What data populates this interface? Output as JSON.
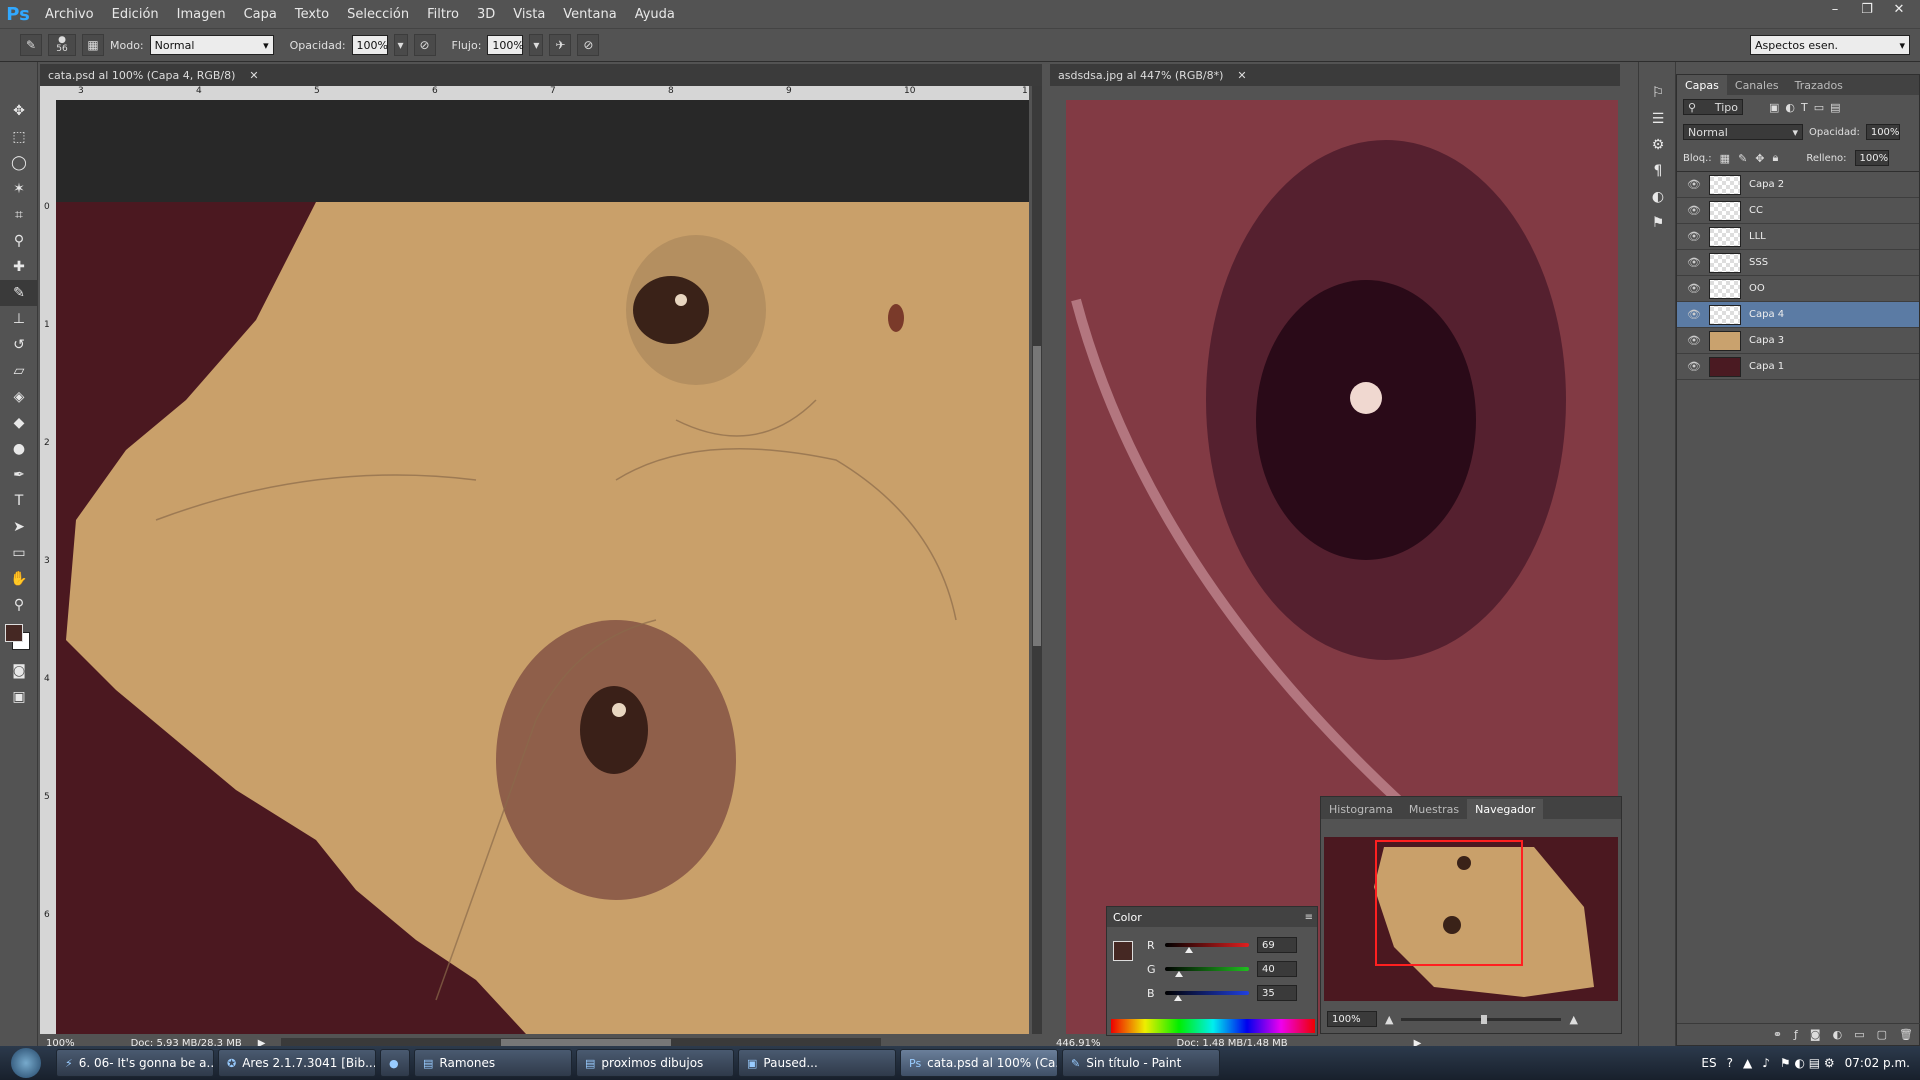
{
  "app": {
    "logo": "Ps"
  },
  "menu": [
    "Archivo",
    "Edición",
    "Imagen",
    "Capa",
    "Texto",
    "Selección",
    "Filtro",
    "3D",
    "Vista",
    "Ventana",
    "Ayuda"
  ],
  "window_controls": [
    "–",
    "❐",
    "✕"
  ],
  "options_bar": {
    "brush_size": "56",
    "mode_label": "Modo:",
    "mode_value": "Normal",
    "opacity_label": "Opacidad:",
    "opacity_value": "100%",
    "flow_label": "Flujo:",
    "flow_value": "100%",
    "workspace": "Aspectos esen."
  },
  "documents": [
    {
      "tab": "cata.psd al 100% (Capa 4, RGB/8)",
      "zoom": "100%",
      "doc_info": "Doc: 5,93 MB/28,3 MB",
      "ruler_marks": [
        "3",
        "4",
        "5",
        "6",
        "7",
        "8",
        "9",
        "10",
        "1"
      ],
      "v_ruler_marks": [
        "0",
        "1",
        "2",
        "3",
        "4",
        "5",
        "6"
      ]
    },
    {
      "tab": "asdsdsa.jpg al 447% (RGB/8*)",
      "zoom": "446,91%",
      "doc_info": "Doc: 1,48 MB/1,48 MB"
    }
  ],
  "layers_panel": {
    "tabs": [
      "Capas",
      "Canales",
      "Trazados"
    ],
    "filter": "Tipo",
    "blend_mode": "Normal",
    "opacity_label": "Opacidad:",
    "opacity_value": "100%",
    "lock_label": "Bloq.:",
    "fill_label": "Relleno:",
    "fill_value": "100%",
    "layers": [
      {
        "name": "Capa 2",
        "thumb": "checker",
        "selected": false
      },
      {
        "name": "CC",
        "thumb": "checker",
        "selected": false
      },
      {
        "name": "LLL",
        "thumb": "checker",
        "selected": false
      },
      {
        "name": "SSS",
        "thumb": "checker",
        "selected": false
      },
      {
        "name": "OO",
        "thumb": "checker",
        "selected": false
      },
      {
        "name": "Capa 4",
        "thumb": "checker",
        "selected": true
      },
      {
        "name": "Capa 3",
        "thumb": "#c9a26e",
        "selected": false
      },
      {
        "name": "Capa 1",
        "thumb": "#4a1a22",
        "selected": false
      }
    ]
  },
  "navigator_panel": {
    "tabs": [
      "Histograma",
      "Muestras",
      "Navegador"
    ],
    "zoom": "100%"
  },
  "color_panel": {
    "title": "Color",
    "channels": [
      {
        "label": "R",
        "value": "69",
        "fraction": 0.27,
        "color": "#e02020"
      },
      {
        "label": "G",
        "value": "40",
        "fraction": 0.16,
        "color": "#20c020"
      },
      {
        "label": "B",
        "value": "35",
        "fraction": 0.14,
        "color": "#2040e0"
      }
    ],
    "foreground": "#452823"
  },
  "taskbar": {
    "buttons": [
      {
        "label": "6. 06- It's gonna be a...",
        "icon": "⚡",
        "active": false
      },
      {
        "label": "Ares 2.1.7.3041    [Bib...",
        "icon": "✪",
        "active": false
      },
      {
        "label": "",
        "icon": "●",
        "active": false
      },
      {
        "label": "Ramones",
        "icon": "▤",
        "active": false
      },
      {
        "label": "proximos dibujos",
        "icon": "▤",
        "active": false
      },
      {
        "label": "Paused...",
        "icon": "▣",
        "active": false
      },
      {
        "label": "cata.psd al 100% (Ca...",
        "icon": "Ps",
        "active": true
      },
      {
        "label": "Sin título - Paint",
        "icon": "✎",
        "active": false
      }
    ],
    "lang": "ES",
    "clock": "07:02 p.m."
  }
}
